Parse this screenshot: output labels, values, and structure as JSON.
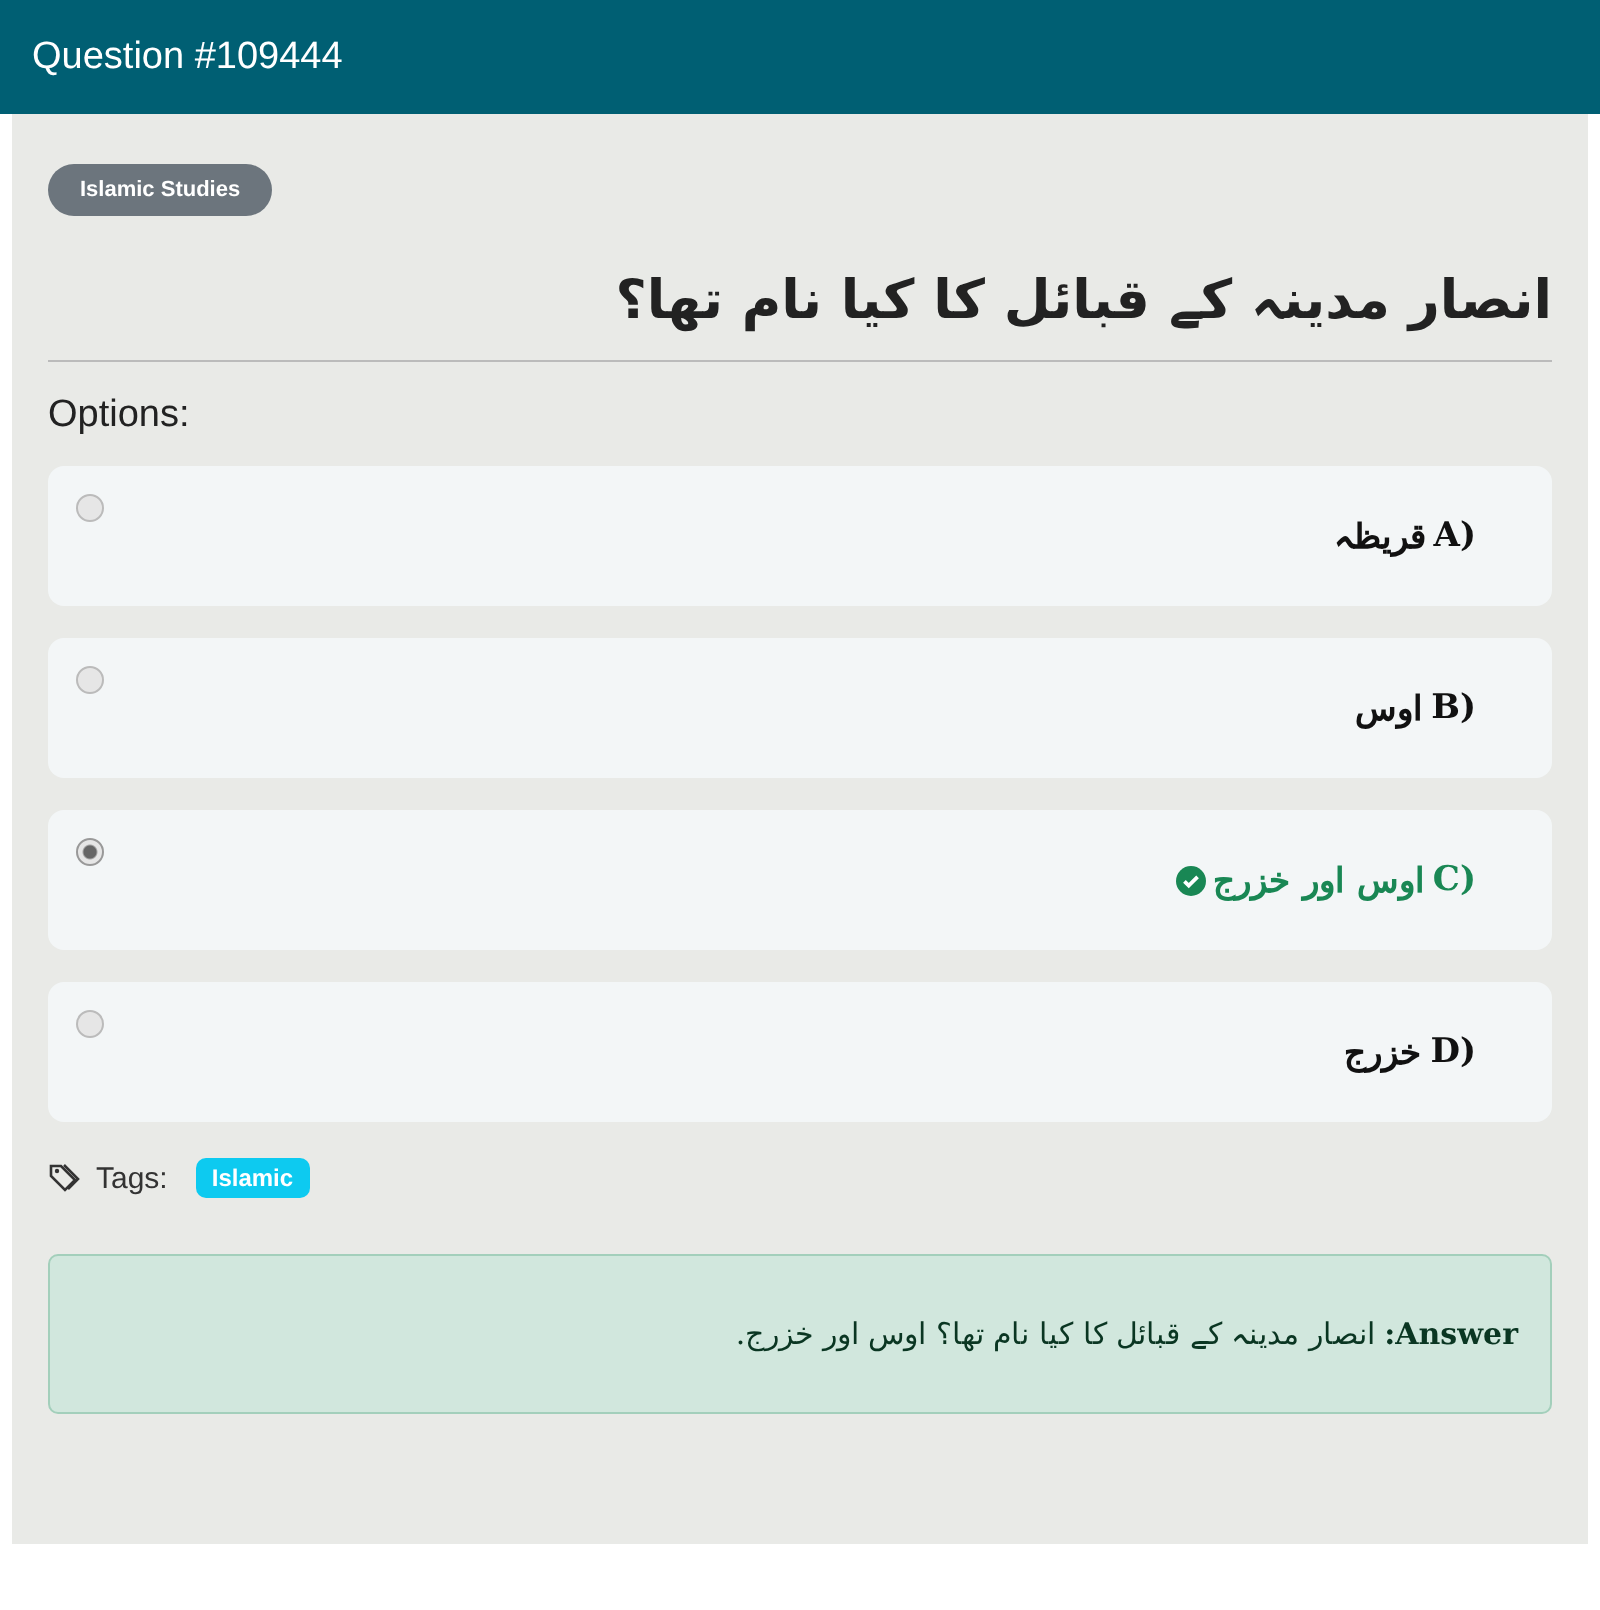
{
  "header": {
    "title": "Question #109444"
  },
  "category": "Islamic Studies",
  "question": "انصار مدینہ کے قبائل کا کیا نام تھا؟",
  "options_label": "Options:",
  "options": [
    {
      "letter": "A)",
      "text": "قریظہ",
      "selected": false,
      "correct": false
    },
    {
      "letter": "B)",
      "text": "اوس",
      "selected": false,
      "correct": false
    },
    {
      "letter": "C)",
      "text": "اوس اور خزرج",
      "selected": true,
      "correct": true
    },
    {
      "letter": "D)",
      "text": "خزرج",
      "selected": false,
      "correct": false
    }
  ],
  "tags_label": "Tags:",
  "tags": [
    "Islamic"
  ],
  "answer": "**Answer:** انصار مدینہ کے قبائل کا کیا نام تھا؟ اوس اور خزرج."
}
